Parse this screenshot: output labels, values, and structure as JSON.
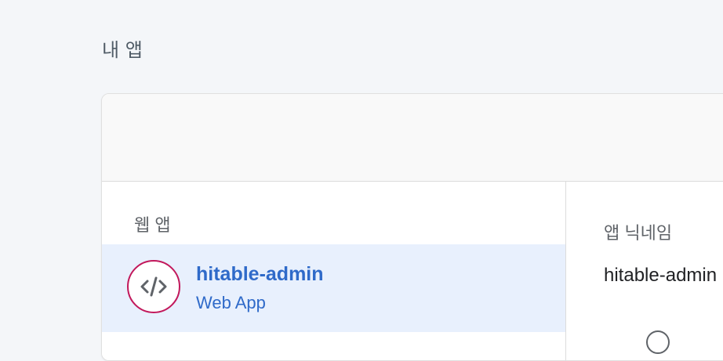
{
  "page": {
    "title": "내 앱"
  },
  "card": {
    "section_label": "웹 앱",
    "app": {
      "name": "hitable-admin",
      "type": "Web App",
      "icon": "code-icon"
    },
    "details": {
      "nickname_label": "앱 닉네임",
      "nickname_value": "hitable-admin"
    }
  },
  "colors": {
    "background": "#f4f6f9",
    "selected_row": "#e8f0fd",
    "accent_blue": "#2f6ac9",
    "icon_ring": "#c2185b"
  }
}
